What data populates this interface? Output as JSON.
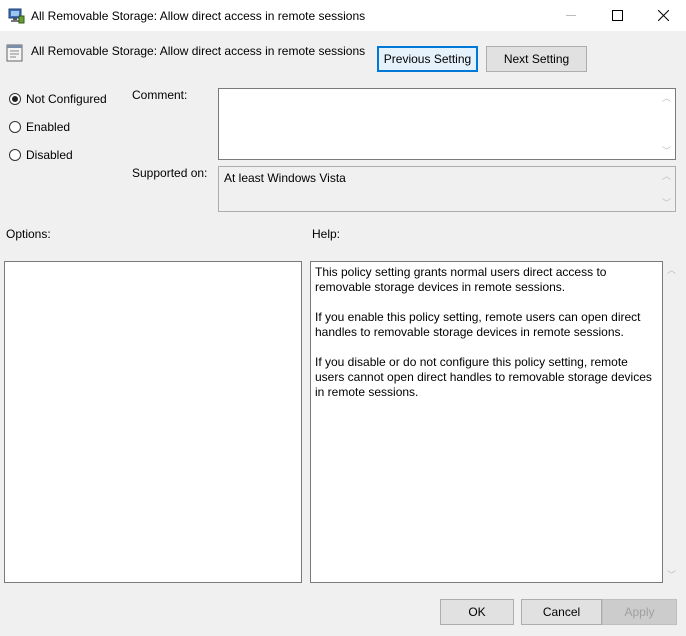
{
  "window": {
    "title": "All Removable Storage: Allow direct access in remote sessions"
  },
  "header": {
    "title": "All Removable Storage: Allow direct access in remote sessions",
    "prev_label": "Previous Setting",
    "next_label": "Next Setting"
  },
  "state": {
    "options": [
      {
        "label": "Not Configured",
        "checked": true
      },
      {
        "label": "Enabled",
        "checked": false
      },
      {
        "label": "Disabled",
        "checked": false
      }
    ]
  },
  "comment": {
    "label": "Comment:",
    "value": ""
  },
  "supported": {
    "label": "Supported on:",
    "value": "At least Windows Vista"
  },
  "options_panel": {
    "label": "Options:"
  },
  "help_panel": {
    "label": "Help:",
    "paragraphs": [
      "This policy setting grants normal users direct access to removable storage devices in remote sessions.",
      "If you enable this policy setting, remote users can open direct handles to removable storage devices in remote sessions.",
      "If you disable or do not configure this policy setting, remote users cannot open direct handles to removable storage devices in remote sessions."
    ]
  },
  "footer": {
    "ok_label": "OK",
    "cancel_label": "Cancel",
    "apply_label": "Apply"
  }
}
